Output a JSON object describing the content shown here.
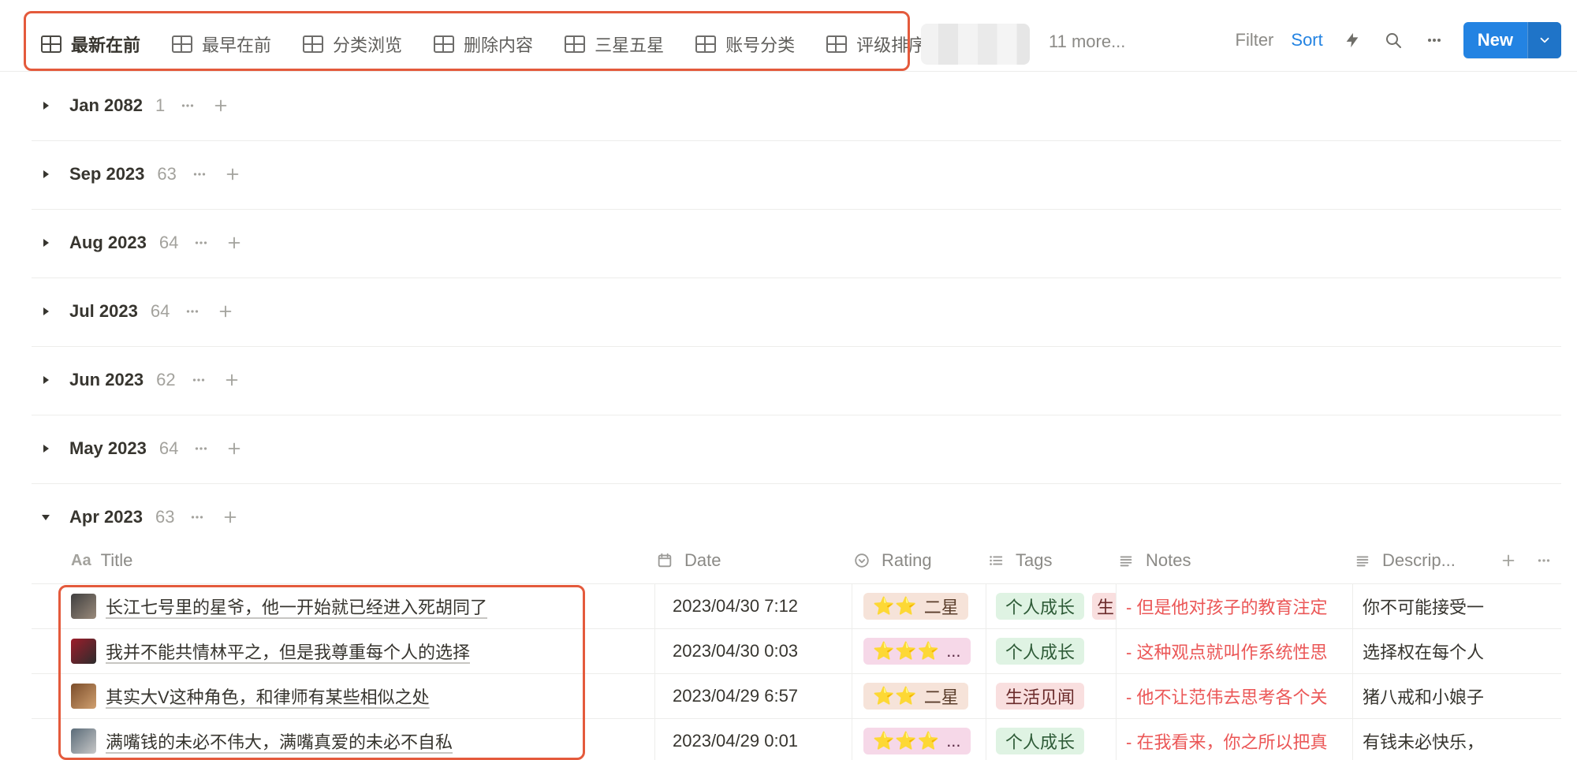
{
  "topbar": {
    "tabs": [
      {
        "label": "最新在前",
        "active": true
      },
      {
        "label": "最早在前",
        "active": false
      },
      {
        "label": "分类浏览",
        "active": false
      },
      {
        "label": "删除内容",
        "active": false
      },
      {
        "label": "三星五星",
        "active": false
      },
      {
        "label": "账号分类",
        "active": false
      },
      {
        "label": "评级排序",
        "active": false
      }
    ],
    "more_label": "11 more...",
    "filter_label": "Filter",
    "sort_label": "Sort",
    "new_label": "New",
    "colors": {
      "accent": "#2383e2",
      "highlight": "#e45a3c"
    }
  },
  "groups": [
    {
      "label": "Jan 2082",
      "count": "1",
      "expanded": false
    },
    {
      "label": "Sep 2023",
      "count": "63",
      "expanded": false
    },
    {
      "label": "Aug 2023",
      "count": "64",
      "expanded": false
    },
    {
      "label": "Jul 2023",
      "count": "64",
      "expanded": false
    },
    {
      "label": "Jun 2023",
      "count": "62",
      "expanded": false
    },
    {
      "label": "May 2023",
      "count": "64",
      "expanded": false
    },
    {
      "label": "Apr 2023",
      "count": "63",
      "expanded": true
    }
  ],
  "table": {
    "headers": {
      "title_prefix": "Aa",
      "title": "Title",
      "date": "Date",
      "rating": "Rating",
      "tags": "Tags",
      "notes": "Notes",
      "desc": "Descrip..."
    },
    "rows": [
      {
        "title": "长江七号里的星爷，他一开始就已经进入死胡同了",
        "date": "2023/04/30 7:12",
        "rating": {
          "stars": "⭐⭐",
          "label": "二星",
          "variant": "rating-2"
        },
        "tags": [
          "个人成长",
          "生"
        ],
        "notes": "- 但是他对孩子的教育注定",
        "desc": "你不可能接受一"
      },
      {
        "title": "我并不能共情林平之，但是我尊重每个人的选择",
        "date": "2023/04/30 0:03",
        "rating": {
          "stars": "⭐⭐⭐",
          "label": "...",
          "variant": "rating-3"
        },
        "tags": [
          "个人成长"
        ],
        "notes": "- 这种观点就叫作系统性思",
        "desc": "选择权在每个人"
      },
      {
        "title": "其实大V这种角色，和律师有某些相似之处",
        "date": "2023/04/29 6:57",
        "rating": {
          "stars": "⭐⭐",
          "label": "二星",
          "variant": "rating-2"
        },
        "tags": [
          "生活见闻"
        ],
        "notes": "- 他不让范伟去思考各个关",
        "desc": "猪八戒和小娘子"
      },
      {
        "title": "满嘴钱的未必不伟大，满嘴真爱的未必不自私",
        "date": "2023/04/29 0:01",
        "rating": {
          "stars": "⭐⭐⭐",
          "label": "...",
          "variant": "rating-3"
        },
        "tags": [
          "个人成长"
        ],
        "notes": "- 在我看来，你之所以把真",
        "desc": "有钱未必快乐，"
      }
    ]
  }
}
